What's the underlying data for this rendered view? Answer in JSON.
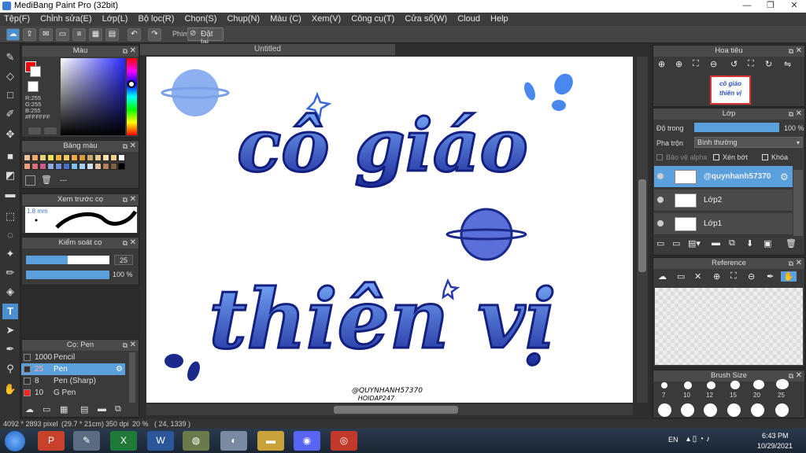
{
  "window": {
    "title": "MediBang Paint Pro (32bit)"
  },
  "menu": [
    "Tệp(F)",
    "Chỉnh sửa(E)",
    "Lớp(L)",
    "Bộ lọc(R)",
    "Chọn(S)",
    "Chụp(N)",
    "Màu (C)",
    "Xem(V)",
    "Công cụ(T)",
    "Cửa sổ(W)",
    "Cloud",
    "Help"
  ],
  "toolbar": {
    "shortcut_label": "Phím",
    "reset_label": "Đặt lại"
  },
  "color_panel": {
    "title": "Màu",
    "rgb": [
      "R:255",
      "G:255",
      "B:255"
    ],
    "hex": "#FFFFFF",
    "primary_color": "#ff0000",
    "secondary_color": "#ffffff"
  },
  "palette_panel": {
    "title": "Bảng màu",
    "extra": "---"
  },
  "brush_preview": {
    "title": "Xem trước cọ",
    "size": "1.8 mm"
  },
  "brush_control": {
    "title": "Kiểm soát cọ",
    "size_value": "25",
    "opacity_value": "100 %",
    "size_fraction": 0.5,
    "opacity_fraction": 1.0
  },
  "brush_panel": {
    "title": "Cọ: Pen",
    "items": [
      {
        "size": "1000",
        "name": "Pencil",
        "color": "#333333",
        "selected": false
      },
      {
        "size": "25",
        "name": "Pen",
        "color": "#333333",
        "selected": true
      },
      {
        "size": "8",
        "name": "Pen (Sharp)",
        "color": "#333333",
        "selected": false
      },
      {
        "size": "10",
        "name": "G Pen",
        "color": "#ff2222",
        "selected": false
      }
    ]
  },
  "document": {
    "tab": "Untitled",
    "artwork_line1": "cô giáo",
    "artwork_line2": "thiên vị",
    "watermark_1": "@QUYNHANH57370",
    "watermark_2": "HOIDAP247"
  },
  "navigator": {
    "title": "Hoa tiêu",
    "thumb_text": "cô giáo thiên vị"
  },
  "layer_panel": {
    "title": "Lớp",
    "opacity_label": "Độ trong",
    "opacity_value": "100 %",
    "opacity_fraction": 1.0,
    "blend_label": "Pha trộn",
    "blend_value": "Bình thường",
    "protect_alpha": "Bảo vệ alpha",
    "clipping": "Xén bớt",
    "lock": "Khóa",
    "layers": [
      "@quynhanh57370",
      "Lớp2",
      "Lớp1"
    ]
  },
  "reference_panel": {
    "title": "Reference"
  },
  "brush_size_panel": {
    "title": "Brush Size",
    "sizes": [
      "7",
      "10",
      "12",
      "15",
      "20",
      "25"
    ]
  },
  "status": {
    "dimensions": "4092 * 2893 pixel",
    "paper": "(29.7 * 21cm)",
    "dpi": "350 dpi",
    "zoom": "20 %",
    "coords": "( 24, 1339 )"
  },
  "taskbar": {
    "lang": "EN",
    "time": "6:43 PM",
    "date": "10/29/2021"
  },
  "colors": {
    "accent": "#5aa0dc",
    "art_blue": "#2a52be",
    "dark_blue": "#1a2a8a"
  }
}
